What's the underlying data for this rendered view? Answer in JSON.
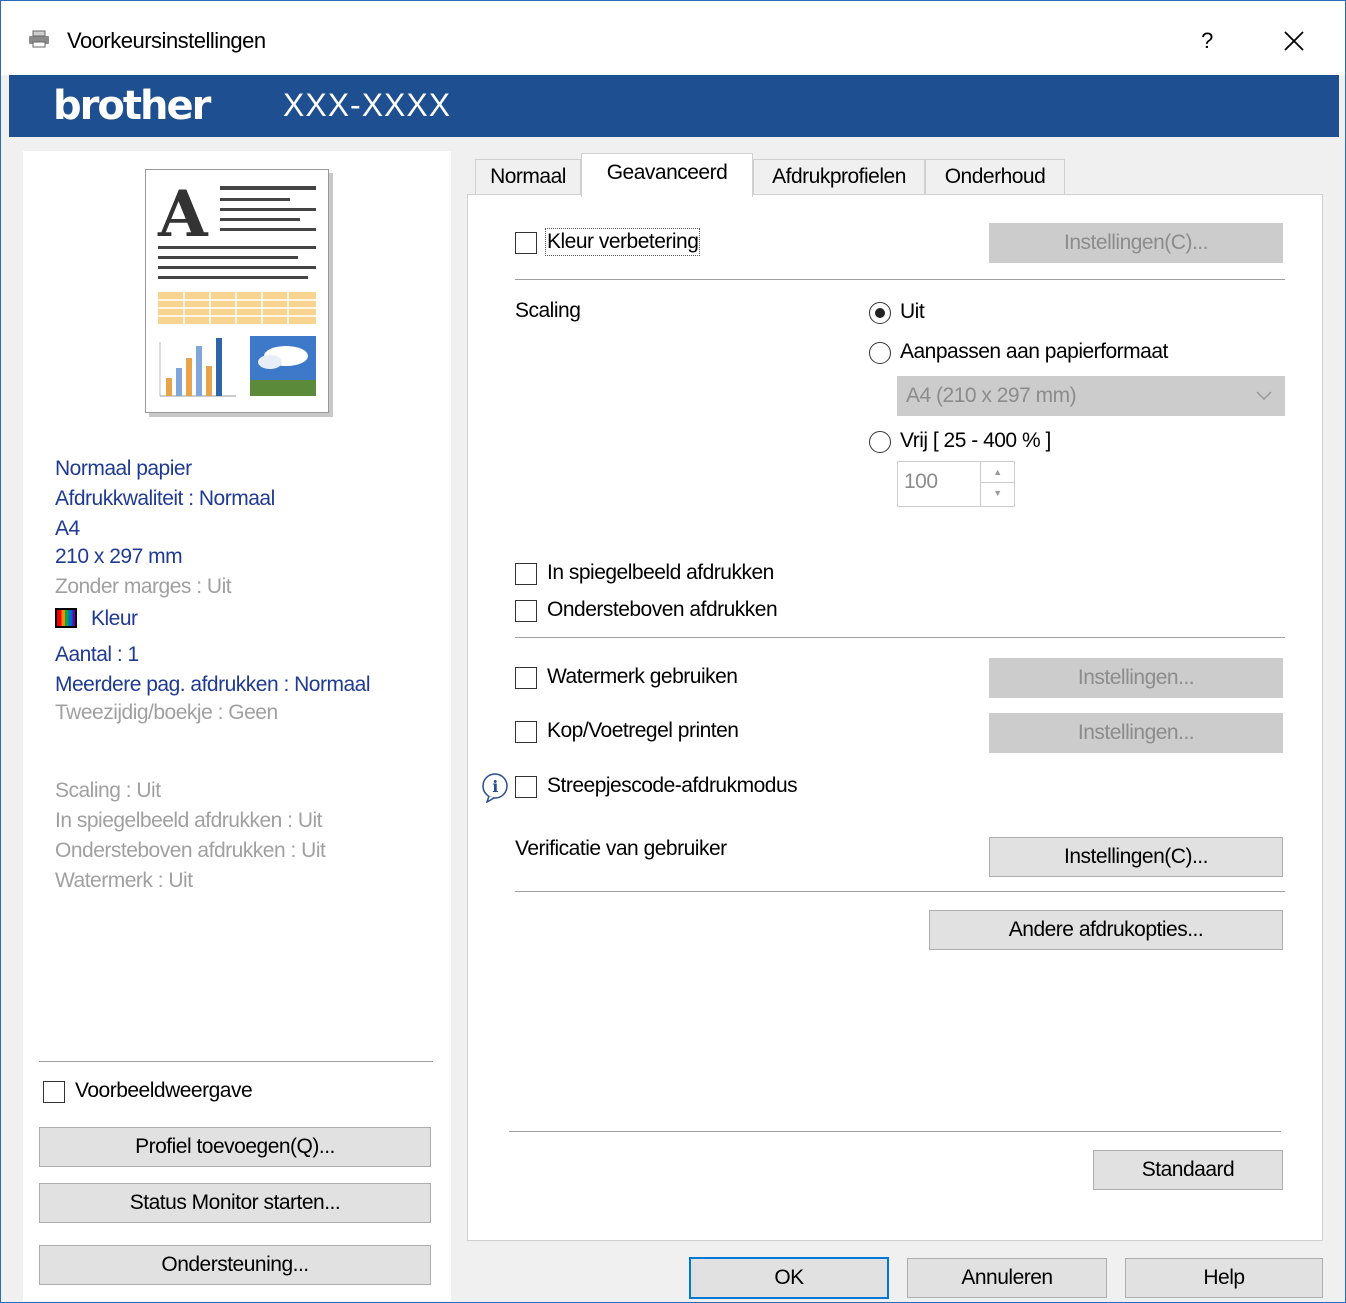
{
  "window": {
    "title": "Voorkeursinstellingen",
    "help": "?",
    "close": "✕"
  },
  "brand": {
    "logo": "brother",
    "model": "XXX-XXXX"
  },
  "summary": {
    "paper": "Normaal papier",
    "quality": "Afdrukkwaliteit : Normaal",
    "size": "A4",
    "dimensions": "210 x 297 mm",
    "borderless": "Zonder marges : Uit",
    "color": "Kleur",
    "copies": "Aantal : 1",
    "multipage": "Meerdere pag. afdrukken : Normaal",
    "duplex": "Tweezijdig/boekje : Geen",
    "scaling": "Scaling : Uit",
    "mirror": "In spiegelbeeld afdrukken : Uit",
    "reverse": "Ondersteboven afdrukken : Uit",
    "watermark": "Watermerk : Uit"
  },
  "left": {
    "preview_checkbox": "Voorbeeldweergave",
    "add_profile": "Profiel toevoegen(Q)...",
    "status_monitor": "Status Monitor starten...",
    "support": "Ondersteuning..."
  },
  "tabs": [
    "Normaal",
    "Geavanceerd",
    "Afdrukprofielen",
    "Onderhoud"
  ],
  "advanced": {
    "color_enhance": "Kleur verbetering",
    "color_settings": "Instellingen(C)...",
    "scaling_label": "Scaling",
    "scaling_off": "Uit",
    "scaling_fit": "Aanpassen aan papierformaat",
    "paper_size_value": "A4 (210 x 297 mm)",
    "scaling_free": "Vrij [ 25 - 400 % ]",
    "free_value": "100",
    "mirror": "In spiegelbeeld afdrukken",
    "reverse": "Ondersteboven afdrukken",
    "watermark": "Watermerk gebruiken",
    "watermark_settings": "Instellingen...",
    "header_footer": "Kop/Voetregel printen",
    "header_footer_settings": "Instellingen...",
    "barcode": "Streepjescode-afdrukmodus",
    "user_verification": "Verificatie van gebruiker",
    "verification_settings": "Instellingen(C)...",
    "other_options": "Andere afdrukopties...",
    "default": "Standaard"
  },
  "footer": {
    "ok": "OK",
    "cancel": "Annuleren",
    "help": "Help"
  }
}
